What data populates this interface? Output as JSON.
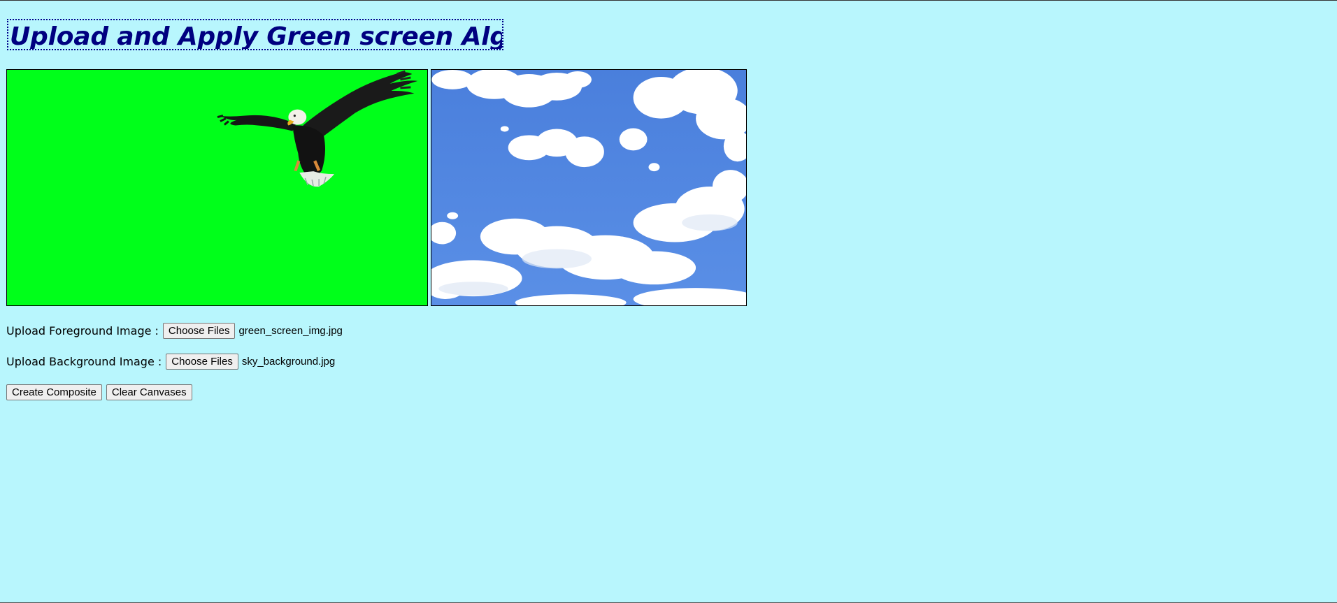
{
  "page": {
    "title": "Upload and Apply Green screen Algorithm",
    "background_color": "#b8f6fd",
    "title_color": "#000080"
  },
  "canvases": {
    "foreground": {
      "description_icon": "eagle-image",
      "fill_color": "#00ff1a"
    },
    "background": {
      "description_icon": "sky-clouds-image",
      "fill_color": "#4f86dd"
    }
  },
  "upload": {
    "foreground": {
      "label": "Upload Foreground Image :",
      "button_label": "Choose Files",
      "file_name": "green_screen_img.jpg"
    },
    "background": {
      "label": "Upload Background Image :",
      "button_label": "Choose Files",
      "file_name": "sky_background.jpg"
    }
  },
  "actions": {
    "create_label": "Create Composite",
    "clear_label": "Clear Canvases"
  }
}
